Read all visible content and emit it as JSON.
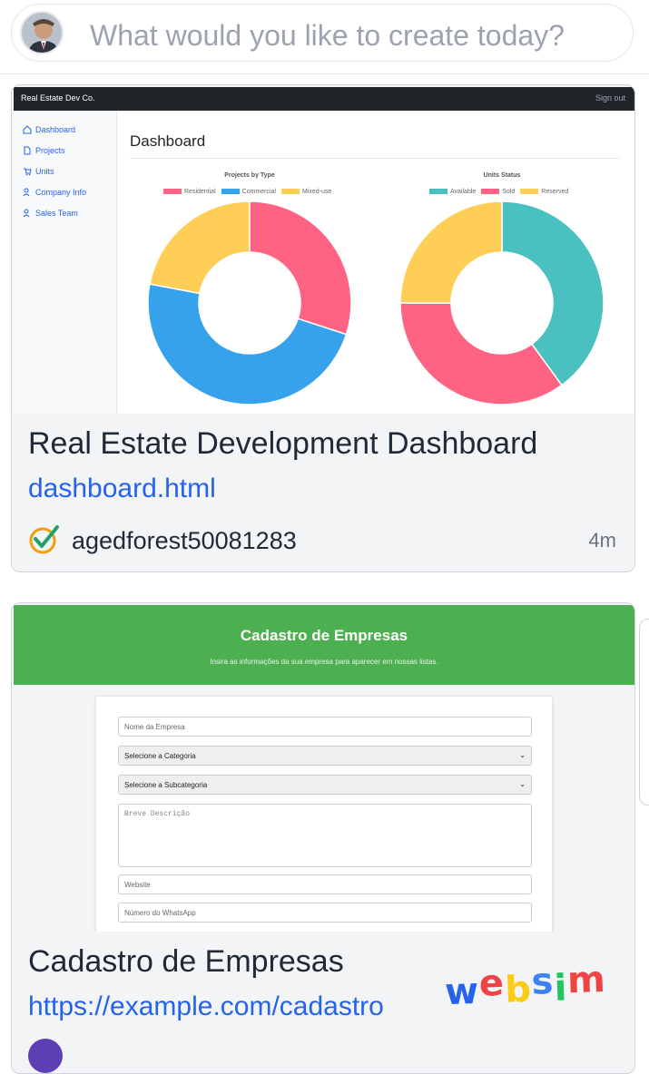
{
  "prompt": {
    "placeholder": "What would you like to create today?"
  },
  "cards": [
    {
      "title": "Real Estate Development Dashboard",
      "link": "dashboard.html",
      "author": "agedforest50081283",
      "time": "4m",
      "preview": {
        "brand": "Real Estate Dev Co.",
        "signout": "Sign out",
        "nav": [
          "Dashboard",
          "Projects",
          "Units",
          "Company Info",
          "Sales Team"
        ],
        "heading": "Dashboard",
        "chart_data": [
          {
            "type": "pie",
            "title": "Projects by Type",
            "categories": [
              "Residential",
              "Commercial",
              "Mixed-use"
            ],
            "values": [
              30,
              48,
              22
            ],
            "colors": [
              "#ff6384",
              "#36a2eb",
              "#ffce56"
            ]
          },
          {
            "type": "pie",
            "title": "Units Status",
            "categories": [
              "Available",
              "Sold",
              "Reserved"
            ],
            "values": [
              40,
              35,
              25
            ],
            "colors": [
              "#4bc0c0",
              "#ff6384",
              "#ffce56"
            ]
          }
        ]
      }
    },
    {
      "title": "Cadastro de Empresas",
      "link": "https://example.com/cadastro",
      "author": "(partially cut off)",
      "time": "",
      "preview": {
        "heading": "Cadastro de Empresas",
        "subheading": "Insira as informações da sua empresa para aparecer em nossas listas.",
        "fields": {
          "name": "Nome da Empresa",
          "category": "Selecione a Categoria",
          "subcategory": "Selecione a Subcategoria",
          "description": "Breve Descrição",
          "website": "Website",
          "whatsapp": "Número do WhatsApp"
        }
      }
    }
  ],
  "watermark": {
    "letters": [
      "w",
      "e",
      "b",
      "s",
      "i",
      "m"
    ],
    "colors": [
      "#2563eb",
      "#ef4444",
      "#facc15",
      "#3b82f6",
      "#22c55e",
      "#ef4444"
    ]
  }
}
